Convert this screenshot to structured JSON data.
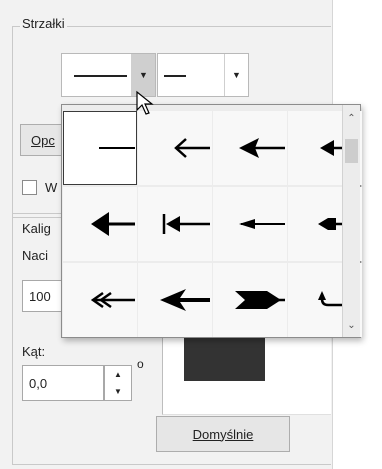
{
  "group1": {
    "legend": "Strzałki"
  },
  "start_combo": {
    "dropdown_icon": "triangle-down"
  },
  "end_combo": {
    "dropdown_icon": "triangle-down"
  },
  "options_button": {
    "label": "Opc"
  },
  "checkbox": {
    "label": "W",
    "checked": false
  },
  "group2": {
    "legend": "Kalig"
  },
  "pen_label": "Naci",
  "size_input": {
    "value": "100"
  },
  "angle": {
    "label": "Kąt:",
    "value": "0,0",
    "unit": "o"
  },
  "default_button": {
    "label": "Domyślnie"
  },
  "arrow_popup": {
    "selected_index": 0,
    "styles": [
      "none",
      "open-thin",
      "filled-triangle",
      "filled-small",
      "filled-large",
      "bar-triangle",
      "long-thin",
      "round-square",
      "double-open",
      "swallow",
      "chevron-fill",
      "hook"
    ]
  },
  "scrollbar": {
    "up_icon": "chevron-up",
    "down_icon": "chevron-down"
  },
  "colors": {
    "panel": "#f2f2f2",
    "swatch": "#333333",
    "arrow": "#000000"
  }
}
